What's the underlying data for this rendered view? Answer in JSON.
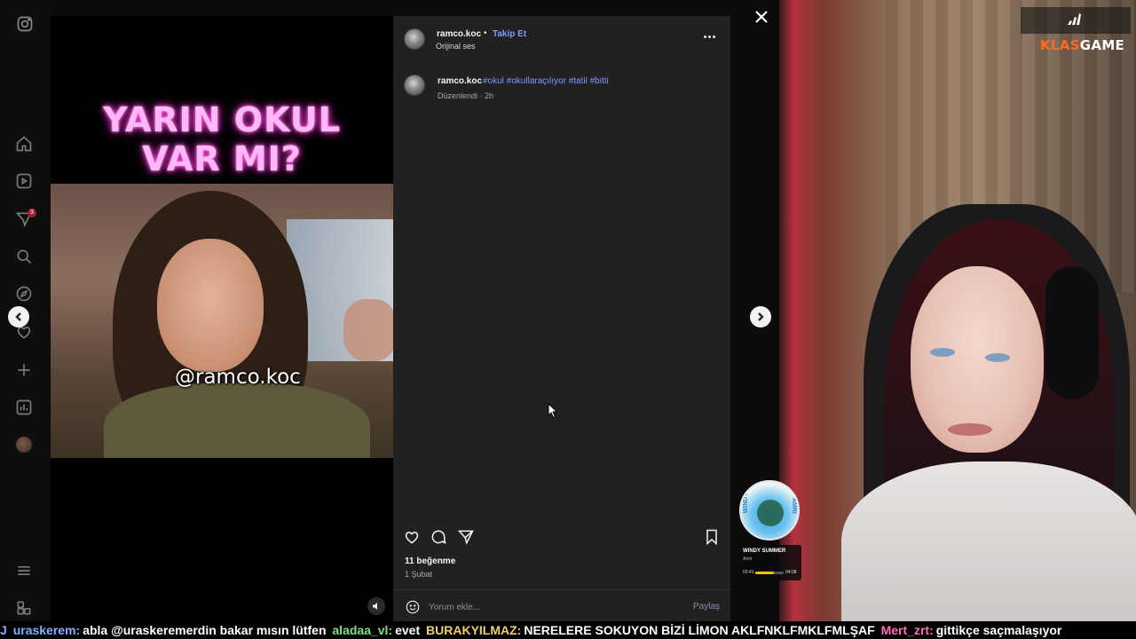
{
  "post": {
    "username": "ramco.koc",
    "dot": "•",
    "follow_label": "Takip Et",
    "audio_label": "Orijinal ses",
    "caption_user": "ramco.koc",
    "caption_tags": "#okul #okullaraçılıyor #tatil #bitti",
    "caption_meta": "Düzenlendi · 2h",
    "likes": "11 beğenme",
    "date": "1 Şubat",
    "comment_placeholder": "Yorum ekle...",
    "share_label": "Paylaş"
  },
  "video": {
    "title_line1": "YARIN OKUL",
    "title_line2": "VAR MI?",
    "watermark": "@ramco.koc"
  },
  "nav": {
    "badge_count": "3"
  },
  "brand": {
    "name_part1": "KLAS",
    "name_part2": "GAME"
  },
  "music": {
    "title": "WINDY SUMMER",
    "artist": "Amri",
    "album_label_left": "WINDY",
    "album_label_right": "AMRI",
    "elapsed": "02:41",
    "total": "04:08",
    "progress_fraction": 0.65
  },
  "chat": [
    {
      "user": "J",
      "msg": "",
      "color": "user"
    },
    {
      "user": "uraskerem:",
      "msg": "abla @uraskeremerdin bakar mısın lütfen",
      "color": "user"
    },
    {
      "user": "aladaa_vl:",
      "msg": "evet",
      "color": "green"
    },
    {
      "user": "BURAKYILMAZ:",
      "msg": "NERELERE SOKUYON BİZİ LİMON AKLFNKLFMKLFMLŞAF",
      "color": "yellow"
    },
    {
      "user": "Mert_zrt:",
      "msg": "gittikçe saçmalaşıyor",
      "color": "pink"
    }
  ],
  "colors": {
    "accent_link": "#7e9bff",
    "panel_bg": "#212121",
    "brand_orange": "#ff6a1a"
  }
}
